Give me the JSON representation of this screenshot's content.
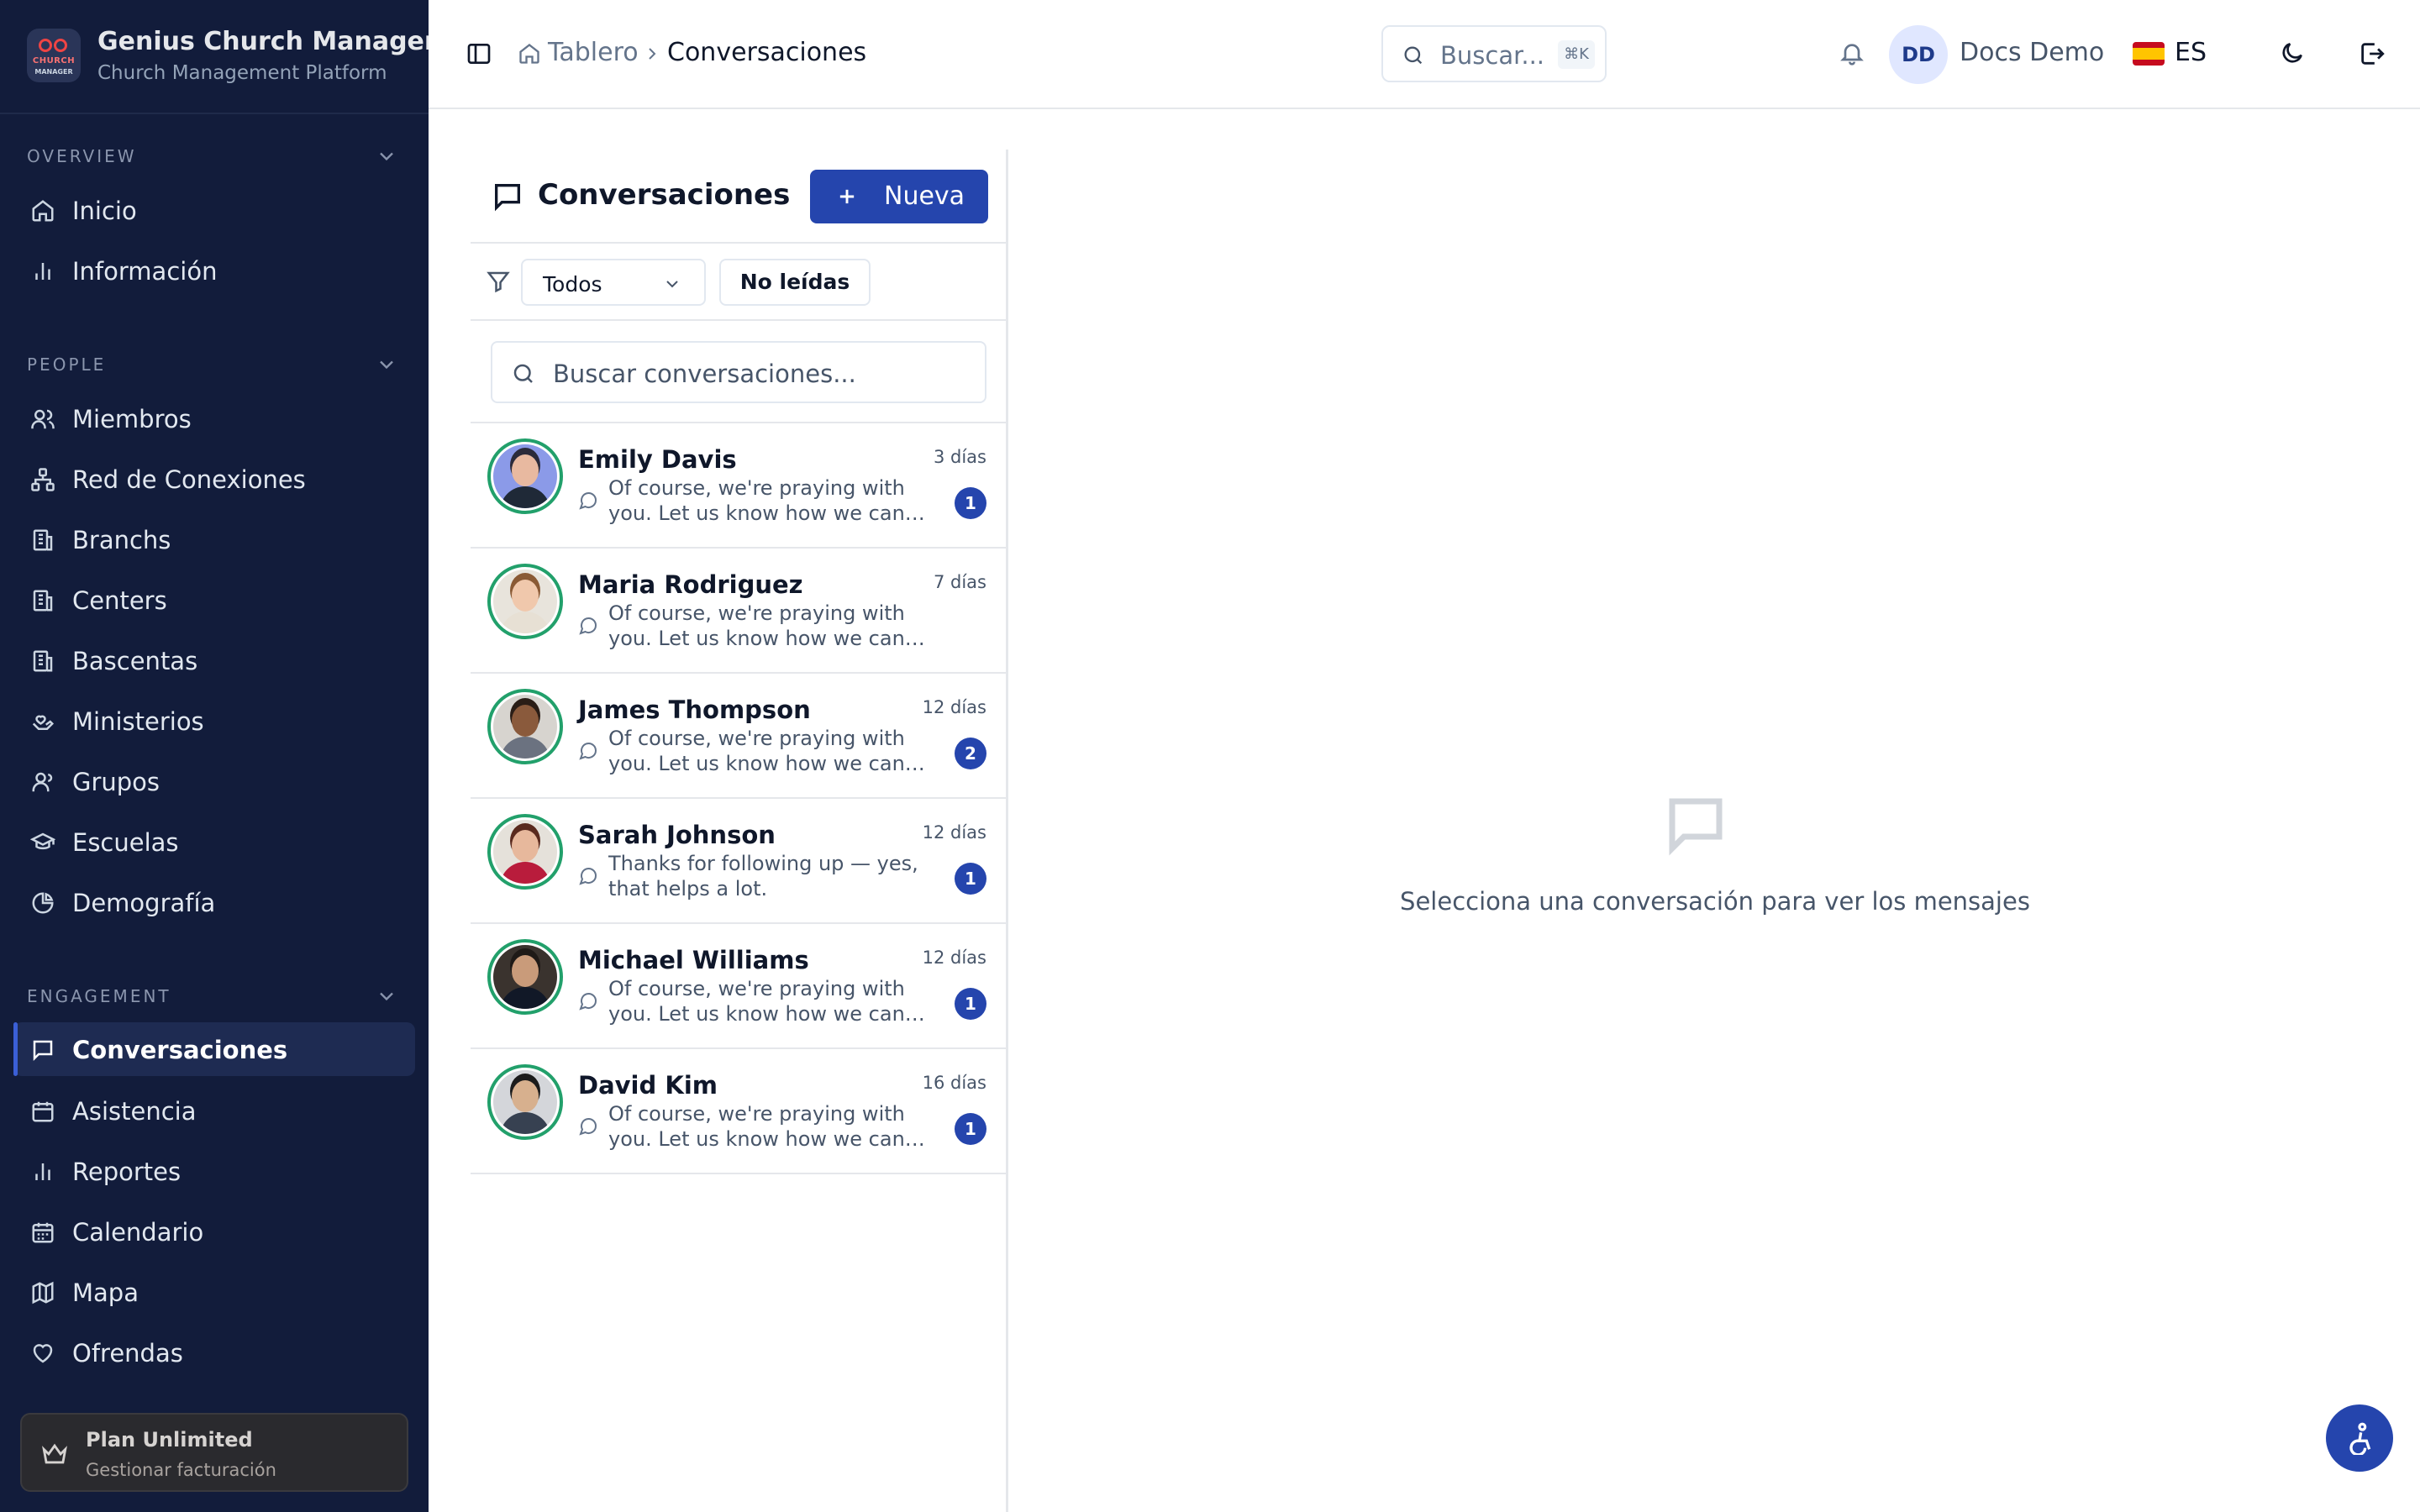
{
  "brand": {
    "name": "Genius Church Manager",
    "subtitle": "Church Management Platform",
    "logo_text_top": "CHURCH",
    "logo_text_bottom": "MANAGER"
  },
  "sidebar": {
    "sections": [
      {
        "title": "OVERVIEW",
        "items": [
          {
            "label": "Inicio",
            "icon": "home-icon"
          },
          {
            "label": "Información",
            "icon": "bar-chart-icon"
          }
        ]
      },
      {
        "title": "PEOPLE",
        "items": [
          {
            "label": "Miembros",
            "icon": "users-icon"
          },
          {
            "label": "Red de Conexiones",
            "icon": "network-icon"
          },
          {
            "label": "Branchs",
            "icon": "building-icon"
          },
          {
            "label": "Centers",
            "icon": "building-icon"
          },
          {
            "label": "Bascentas",
            "icon": "building-icon"
          },
          {
            "label": "Ministerios",
            "icon": "hand-heart-icon"
          },
          {
            "label": "Grupos",
            "icon": "user-group-icon"
          },
          {
            "label": "Escuelas",
            "icon": "graduation-cap-icon"
          },
          {
            "label": "Demografía",
            "icon": "pie-chart-icon"
          }
        ]
      },
      {
        "title": "ENGAGEMENT",
        "items": [
          {
            "label": "Conversaciones",
            "icon": "message-square-icon",
            "active": true
          },
          {
            "label": "Asistencia",
            "icon": "calendar-check-icon"
          },
          {
            "label": "Reportes",
            "icon": "bar-chart-icon"
          },
          {
            "label": "Calendario",
            "icon": "calendar-icon"
          },
          {
            "label": "Mapa",
            "icon": "map-icon"
          },
          {
            "label": "Ofrendas",
            "icon": "heart-icon"
          }
        ]
      }
    ],
    "plan": {
      "name": "Plan Unlimited",
      "subtitle": "Gestionar facturación"
    }
  },
  "header": {
    "breadcrumb": [
      "Tablero",
      "Conversaciones"
    ],
    "search_placeholder": "Buscar...",
    "search_shortcut": "⌘K",
    "user_initials": "DD",
    "user_name": "Docs Demo",
    "language": "ES"
  },
  "conversations": {
    "title": "Conversaciones",
    "new_button": "Nueva",
    "filter_value": "Todos",
    "unread_button": "No leídas",
    "search_placeholder": "Buscar conversaciones...",
    "items": [
      {
        "name": "Emily Davis",
        "time": "3 días",
        "preview": "Of course, we're praying with you. Let us know how we can help...",
        "unread": "1",
        "skin": "#e8b9a0",
        "hair": "#2b2b3a",
        "shirt": "#1f2937",
        "bg": "#8b9ae8"
      },
      {
        "name": "Maria Rodriguez",
        "time": "7 días",
        "preview": "Of course, we're praying with you. Let us know how we can help further.",
        "unread": "",
        "skin": "#f0c8ac",
        "hair": "#8a5a35",
        "shirt": "#e7e0d4",
        "bg": "#e8e4dc"
      },
      {
        "name": "James Thompson",
        "time": "12 días",
        "preview": "Of course, we're praying with you. Let us know how we can help...",
        "unread": "2",
        "skin": "#8a5a3c",
        "hair": "#2a1d16",
        "shirt": "#6b7280",
        "bg": "#d7d4cf"
      },
      {
        "name": "Sarah Johnson",
        "time": "12 días",
        "preview": "Thanks for following up — yes, that helps a lot.",
        "unread": "1",
        "skin": "#e7b89c",
        "hair": "#5a2a1e",
        "shirt": "#b91c3c",
        "bg": "#e5e1da"
      },
      {
        "name": "Michael Williams",
        "time": "12 días",
        "preview": "Of course, we're praying with you. Let us know how we can help...",
        "unread": "1",
        "skin": "#c99b7a",
        "hair": "#1f1a17",
        "shirt": "#111827",
        "bg": "#3a332e"
      },
      {
        "name": "David Kim",
        "time": "16 días",
        "preview": "Of course, we're praying with you. Let us know how we can help...",
        "unread": "1",
        "skin": "#d7b08e",
        "hair": "#1c1c1c",
        "shirt": "#374151",
        "bg": "#d4d6da"
      }
    ]
  },
  "empty_state": {
    "message": "Selecciona una conversación para ver los mensajes"
  },
  "colors": {
    "sidebar_bg": "#121c3b",
    "accent": "#2545ad",
    "avatar_ring": "#22a06b"
  }
}
